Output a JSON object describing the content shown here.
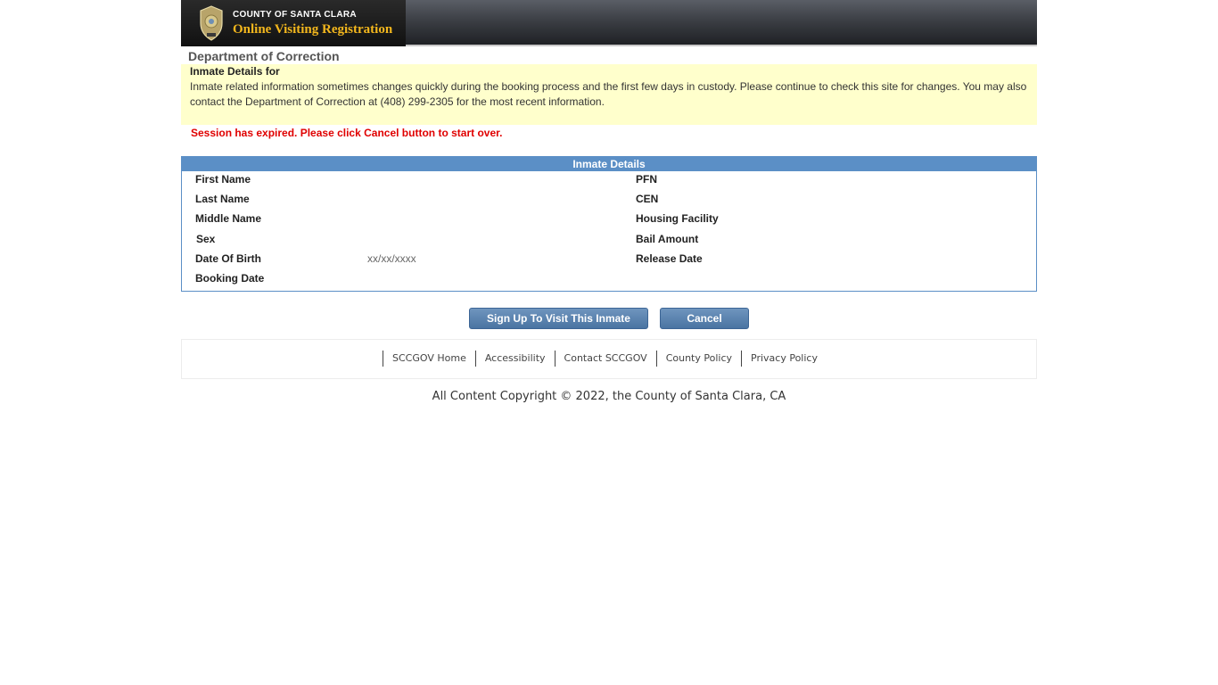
{
  "header": {
    "county_name": "COUNTY OF SANTA CLARA",
    "app_title": "Online Visiting Registration"
  },
  "department": "Department of Correction",
  "notice": {
    "title": "Inmate Details for",
    "text": "Inmate related information sometimes changes quickly during the booking process and the first few days in custody. Please continue to check this site for changes. You may also contact the Department of Correction at (408) 299-2305 for the most recent information."
  },
  "session_message": "Session has expired. Please click Cancel button to start over.",
  "details": {
    "heading": "Inmate Details",
    "left": [
      {
        "label": "First Name",
        "value": ""
      },
      {
        "label": "Last Name",
        "value": ""
      },
      {
        "label": "Middle Name",
        "value": ""
      },
      {
        "label": "Sex",
        "value": ""
      },
      {
        "label": "Date Of Birth",
        "value": "xx/xx/xxxx"
      },
      {
        "label": "Booking Date",
        "value": ""
      }
    ],
    "right": [
      {
        "label": "PFN",
        "value": ""
      },
      {
        "label": "CEN",
        "value": ""
      },
      {
        "label": "Housing Facility",
        "value": ""
      },
      {
        "label": "Bail Amount",
        "value": ""
      },
      {
        "label": "Release Date",
        "value": ""
      }
    ]
  },
  "buttons": {
    "signup": "Sign Up To Visit This Inmate",
    "cancel": "Cancel"
  },
  "footer": {
    "links": [
      "SCCGOV Home",
      "Accessibility",
      "Contact SCCGOV",
      "County Policy",
      "Privacy Policy"
    ],
    "copyright": "All Content Copyright © 2022, the County of Santa Clara, CA"
  },
  "colors": {
    "accent": "#5b8fc6",
    "notice_bg": "#ffffcc",
    "error": "#e00000",
    "logo_gold": "#f3b71d"
  }
}
